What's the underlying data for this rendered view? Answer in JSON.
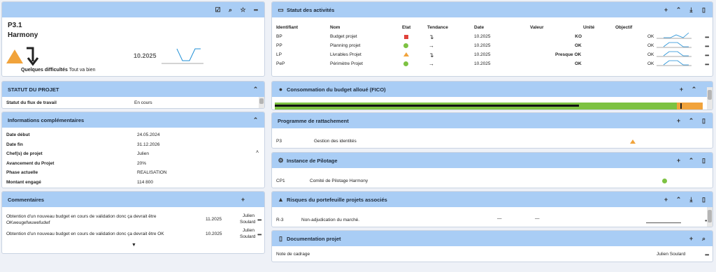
{
  "project": {
    "code": "P3.1",
    "name": "Harmony",
    "date": "10.2025",
    "status_label": "Quelques difficultés",
    "status_sub": "Tout va bien"
  },
  "statut_projet": {
    "title": "STATUT DU PROJET",
    "label": "Statut du flux de travail",
    "value": "En cours"
  },
  "infos": {
    "title": "Informations complémentaires",
    "rows": [
      {
        "label": "Date début",
        "value": "24.05.2024"
      },
      {
        "label": "Date fin",
        "value": "31.12.2026"
      },
      {
        "label": "Chef(s) de projet",
        "value": "Julien"
      },
      {
        "label": "Avancement du Projet",
        "value": "20%"
      },
      {
        "label": "Phase actuelle",
        "value": "REALISATION"
      },
      {
        "label": "Montant engagé",
        "value": "114 800"
      }
    ]
  },
  "commentaires": {
    "title": "Commentaires",
    "items": [
      {
        "text1": "Obtention d'un nouveau budget en cours de validation donc ça devrait être",
        "text2": "OKweugefwuwefudwf",
        "date": "11.2025",
        "author1": "Julien",
        "author2": "Soulard"
      },
      {
        "text1": "Obtention d'un nouveau budget en cours de validation donc ça devrait être OK",
        "text2": "",
        "date": "10.2025",
        "author1": "Julien",
        "author2": "Soulard"
      }
    ]
  },
  "activites": {
    "title": "Statut des activités",
    "columns": [
      "Identifiant",
      "Nom",
      "Etat",
      "Tendance",
      "Date",
      "Valeur",
      "Unité",
      "Objectif"
    ],
    "rows": [
      {
        "id": "BP",
        "nom": "Budget projet",
        "etat": "red-square",
        "tendance": "↴",
        "date": "10.2025",
        "unite": "KO",
        "objectif": "OK"
      },
      {
        "id": "PP",
        "nom": "Planning projet",
        "etat": "green-dot",
        "tendance": "→",
        "date": "10.2025",
        "unite": "OK",
        "objectif": "OK"
      },
      {
        "id": "LP",
        "nom": "Livrables Projet",
        "etat": "orange-triangle",
        "tendance": "↴",
        "date": "10.2025",
        "unite": "Presque OK",
        "objectif": "OK"
      },
      {
        "id": "PeP",
        "nom": "Périmètre Projet",
        "etat": "green-dot",
        "tendance": "→",
        "date": "10.2025",
        "unite": "OK",
        "objectif": "OK"
      }
    ]
  },
  "budget": {
    "title": "Consommation du budget alloué (FICO)",
    "consumed_fraction": 0.71,
    "green_fraction": 0.94
  },
  "rattachement": {
    "title": "Programme de rattachement",
    "id": "P3",
    "name": "Gestion des identités"
  },
  "pilotage": {
    "title": "Instance de Pilotage",
    "id": "CP1",
    "name": "Comité de Pilotage Harmony"
  },
  "risques": {
    "title": "Risques du portefeuille projets associés",
    "id": "R-3",
    "name": "Non-adjudication du marché.",
    "c1": "—",
    "c2": "—"
  },
  "documentation": {
    "title": "Documentation projet",
    "name": "Note de cadrage",
    "author": "Julien Soulard"
  },
  "colors": {
    "header": "#a9cdf5",
    "green": "#7dc242",
    "orange": "#f1a33b",
    "red": "#e0423b"
  }
}
